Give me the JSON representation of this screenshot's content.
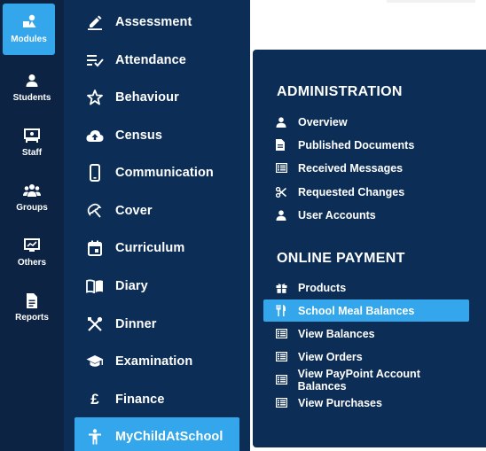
{
  "rail": {
    "items": [
      {
        "label": "Modules",
        "icon": "modules-icon",
        "active": true
      },
      {
        "label": "Students",
        "icon": "student-icon"
      },
      {
        "label": "Staff",
        "icon": "staff-icon"
      },
      {
        "label": "Groups",
        "icon": "groups-icon"
      },
      {
        "label": "Others",
        "icon": "others-icon"
      },
      {
        "label": "Reports",
        "icon": "reports-icon"
      }
    ]
  },
  "modules": {
    "items": [
      {
        "label": "Assessment",
        "icon": "pencil-icon"
      },
      {
        "label": "Attendance",
        "icon": "checklist-icon"
      },
      {
        "label": "Behaviour",
        "icon": "star-icon"
      },
      {
        "label": "Census",
        "icon": "cloud-upload-icon"
      },
      {
        "label": "Communication",
        "icon": "mobile-icon"
      },
      {
        "label": "Cover",
        "icon": "umbrella-icon"
      },
      {
        "label": "Curriculum",
        "icon": "calendar-icon"
      },
      {
        "label": "Diary",
        "icon": "book-open-icon"
      },
      {
        "label": "Dinner",
        "icon": "utensils-icon"
      },
      {
        "label": "Examination",
        "icon": "graduation-cap-icon"
      },
      {
        "label": "Finance",
        "icon": "pound-icon"
      },
      {
        "label": "MyChildAtSchool",
        "icon": "child-icon",
        "active": true
      }
    ]
  },
  "flyout": {
    "administration": {
      "title": "ADMINISTRATION",
      "items": [
        {
          "label": "Overview",
          "icon": "user-icon"
        },
        {
          "label": "Published Documents",
          "icon": "file-icon"
        },
        {
          "label": "Received Messages",
          "icon": "list-icon"
        },
        {
          "label": "Requested Changes",
          "icon": "scissors-icon"
        },
        {
          "label": "User Accounts",
          "icon": "user-icon"
        }
      ]
    },
    "online_payment": {
      "title": "ONLINE PAYMENT",
      "items": [
        {
          "label": "Products",
          "icon": "gift-icon"
        },
        {
          "label": "School Meal Balances",
          "icon": "utensils-icon",
          "active": true
        },
        {
          "label": "View Balances",
          "icon": "list-icon"
        },
        {
          "label": "View Orders",
          "icon": "list-icon"
        },
        {
          "label": "View PayPoint Account Balances",
          "icon": "list-icon"
        },
        {
          "label": "View Purchases",
          "icon": "list-icon"
        }
      ]
    }
  },
  "colors": {
    "rail_bg": "#0c2344",
    "panel_bg": "#0b2d56",
    "accent": "#33a6ec",
    "text": "#ffffff"
  }
}
